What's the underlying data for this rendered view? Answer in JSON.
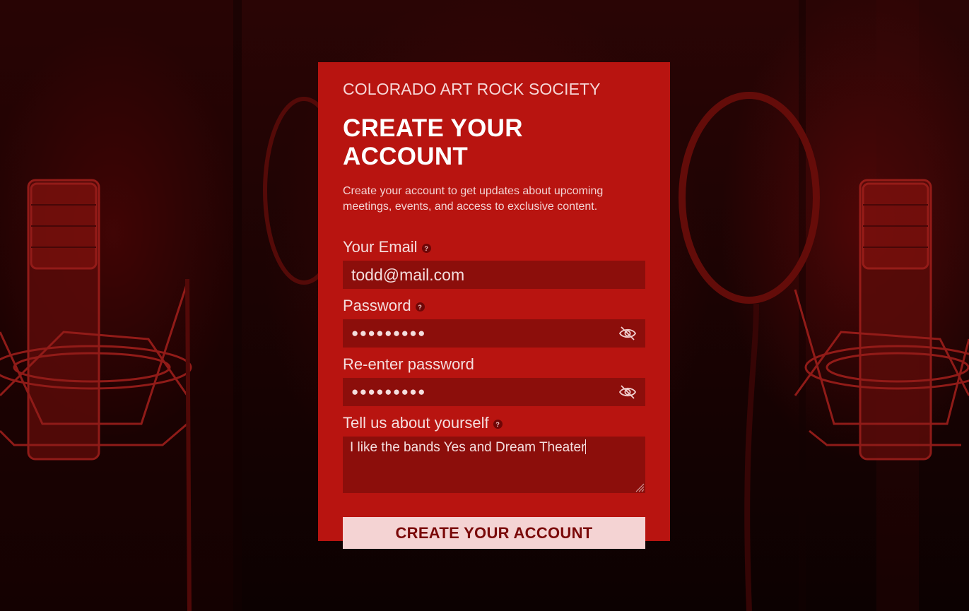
{
  "theme": {
    "card_bg": "#b81410",
    "input_bg": "#8c0e0b",
    "button_bg": "#f4d3d3",
    "button_text": "#7a0909"
  },
  "header": {
    "org_name": "COLORADO ART ROCK SOCIETY",
    "title": "CREATE YOUR ACCOUNT",
    "description": "Create your account to get updates about upcoming meetings, events, and access to exclusive content."
  },
  "form": {
    "email": {
      "label": "Your Email",
      "help": "?",
      "value": "todd@mail.com"
    },
    "password": {
      "label": "Password",
      "help": "?",
      "value": "●●●●●●●●●",
      "toggle_icon": "eye-slash-icon"
    },
    "confirm_password": {
      "label": "Re-enter password",
      "value": "●●●●●●●●●",
      "toggle_icon": "eye-slash-icon"
    },
    "about": {
      "label": "Tell us about yourself",
      "help": "?",
      "value": "I like the bands Yes and Dream Theater"
    },
    "submit_label": "CREATE YOUR ACCOUNT"
  }
}
